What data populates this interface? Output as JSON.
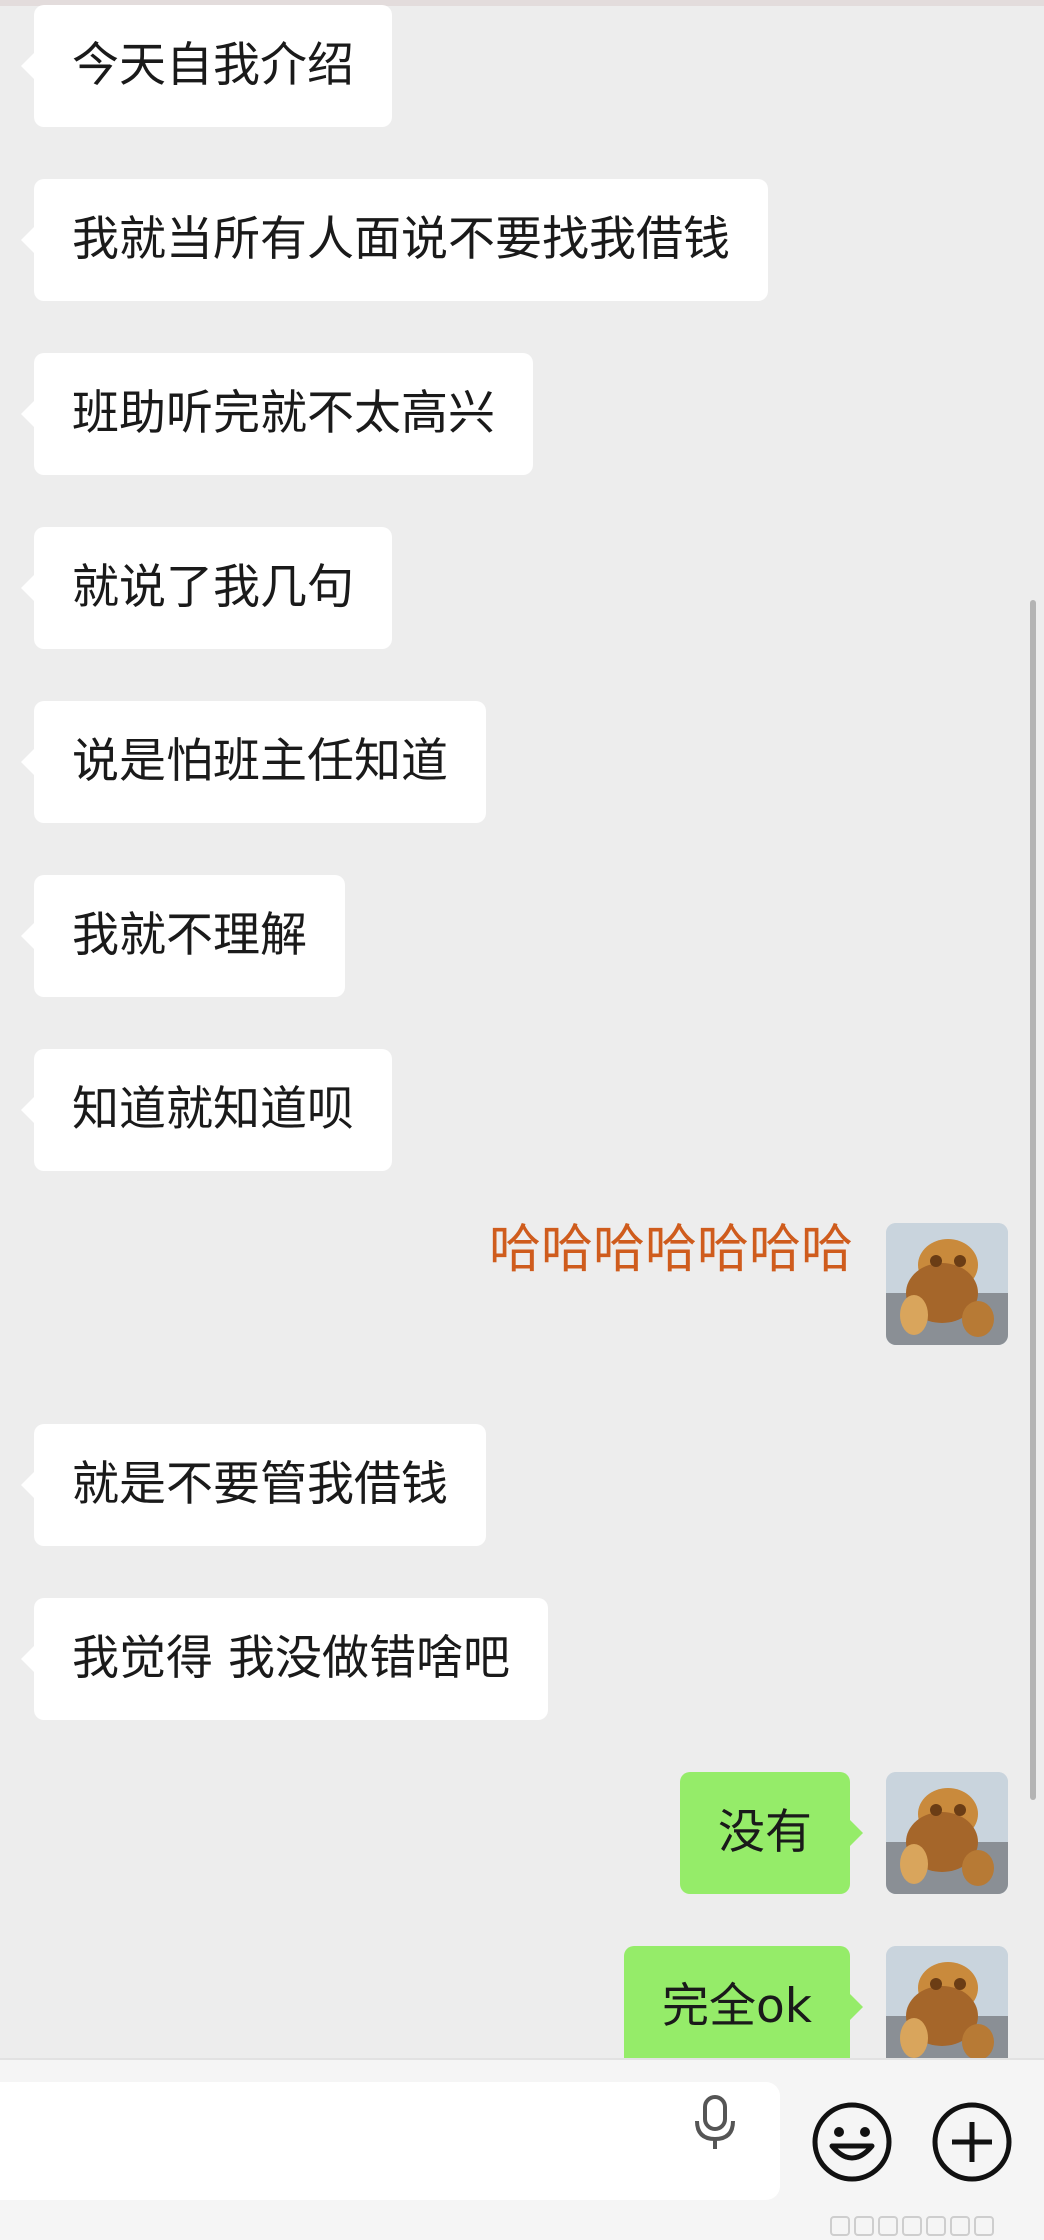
{
  "chat": {
    "messages": [
      {
        "side": "received",
        "text": "今天自我介绍"
      },
      {
        "side": "received",
        "text": "我就当所有人面说不要找我借钱"
      },
      {
        "side": "received",
        "text": "班助听完就不太高兴"
      },
      {
        "side": "received",
        "text": "就说了我几句"
      },
      {
        "side": "received",
        "text": "说是怕班主任知道"
      },
      {
        "side": "received",
        "text": "我就不理解"
      },
      {
        "side": "received",
        "text": "知道就知道呗"
      },
      {
        "side": "sent",
        "type": "sticker",
        "text": "哈哈哈哈哈哈哈"
      },
      {
        "side": "received",
        "text": "就是不要管我借钱"
      },
      {
        "side": "received",
        "text": "我觉得 我没做错啥吧"
      },
      {
        "side": "sent",
        "text": "没有"
      },
      {
        "side": "sent",
        "text": "完全ok"
      }
    ]
  },
  "colors": {
    "background": "#ededed",
    "received_bubble": "#ffffff",
    "sent_bubble": "#95ec69",
    "sticker_text": "#cf5c1d"
  },
  "icons": {
    "voice": "microphone-icon",
    "emoji": "smiley-icon",
    "more": "plus-circle-icon"
  }
}
